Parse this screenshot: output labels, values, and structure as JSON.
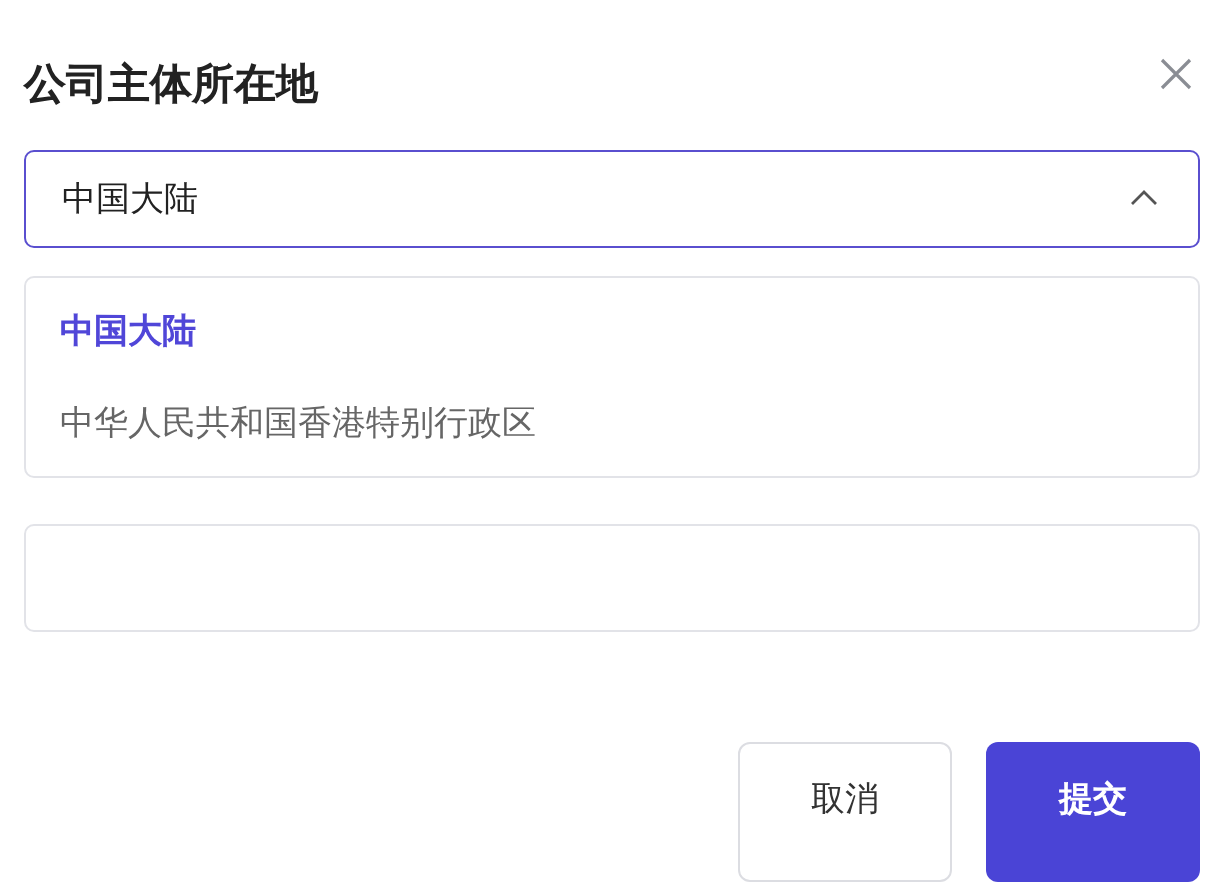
{
  "dialog": {
    "title": "公司主体所在地"
  },
  "select": {
    "value": "中国大陆",
    "expanded": true
  },
  "options": [
    {
      "label": "中国大陆",
      "selected": true
    },
    {
      "label": "中华人民共和国香港特别行政区",
      "selected": false
    }
  ],
  "buttons": [
    {
      "label": "取消",
      "kind": "secondary"
    },
    {
      "label": "提交",
      "kind": "primary"
    }
  ]
}
